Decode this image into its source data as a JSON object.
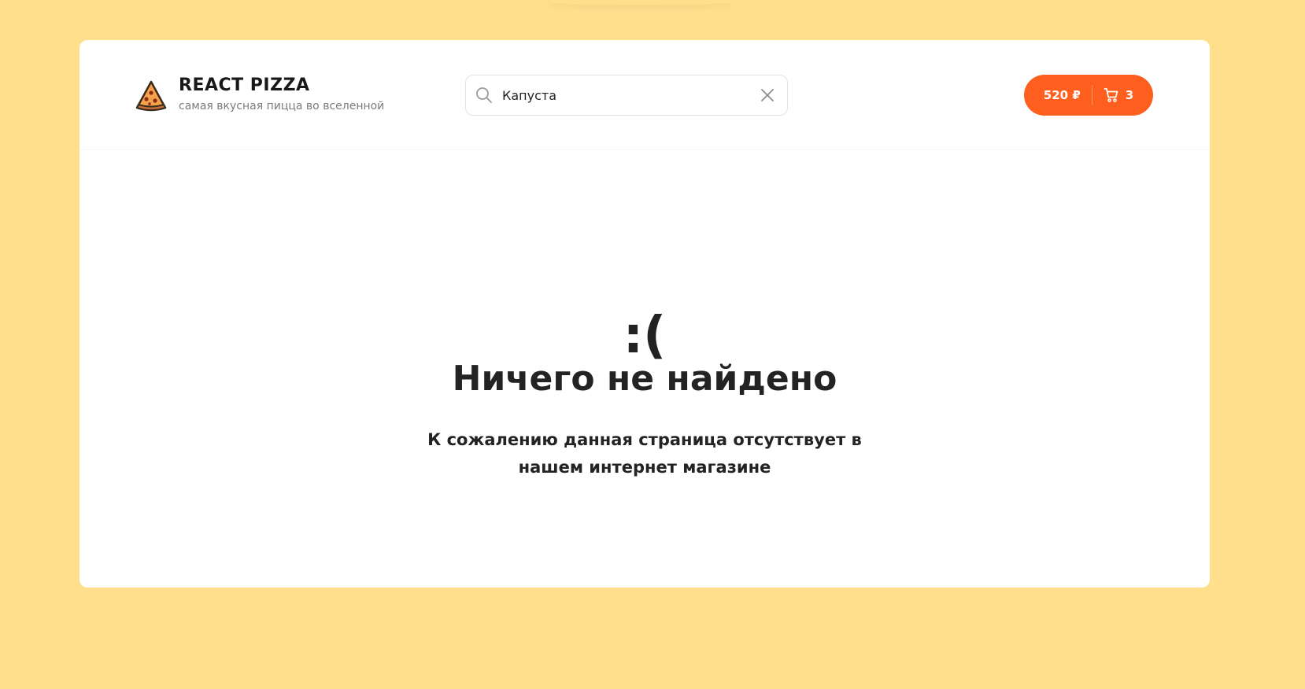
{
  "header": {
    "logo_title": "REACT PIZZA",
    "logo_subtitle": "самая вкусная пицца во вселенной",
    "logo_icon": "pizza-slice-icon"
  },
  "search": {
    "value": "Капуста",
    "icon": "search-icon",
    "clear_icon": "close-icon"
  },
  "cart": {
    "price": "520 ₽",
    "count": "3",
    "icon": "cart-icon",
    "color": "#fe5f1e"
  },
  "empty_state": {
    "emoticon": ":(",
    "title": "Ничего не найдено",
    "description": "К сожалению данная страница отсутствует в нашем интернет магазине"
  },
  "colors": {
    "page_background": "#ffdf8c",
    "card_background": "#ffffff",
    "accent": "#fe5f1e"
  }
}
